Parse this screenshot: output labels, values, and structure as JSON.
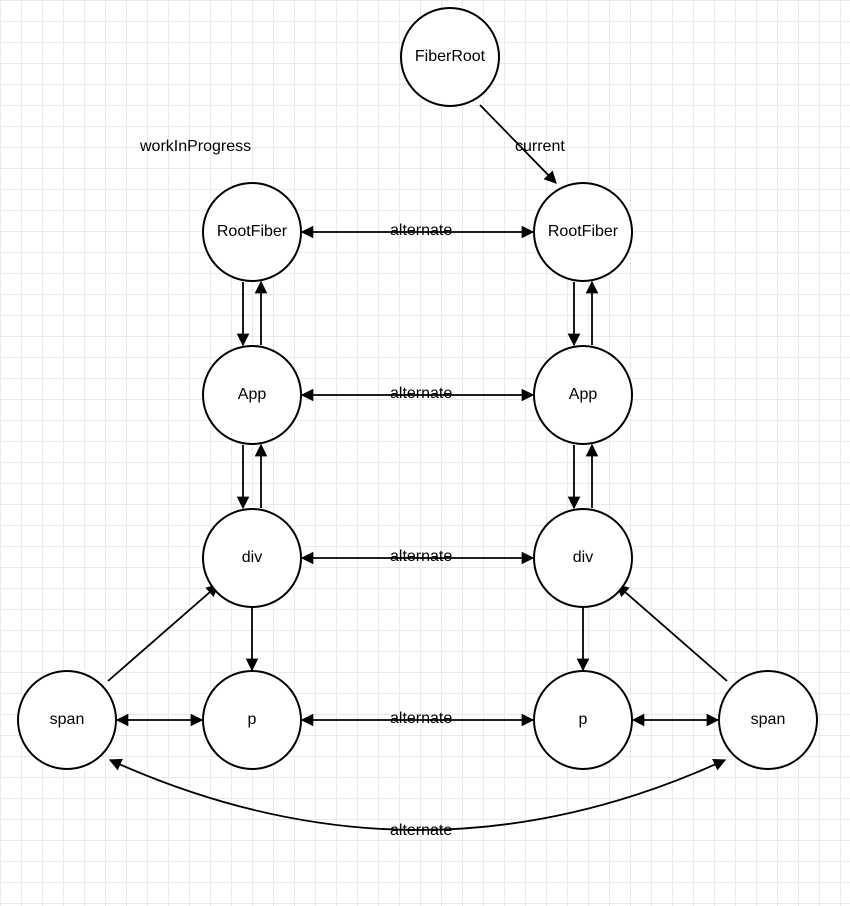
{
  "labels": {
    "workInProgress": "workInProgress",
    "current": "current",
    "alternate": "alternate"
  },
  "nodes": {
    "fiberRoot": "FiberRoot",
    "rootFiber": "RootFiber",
    "app": "App",
    "div": "div",
    "p": "p",
    "span": "span"
  }
}
